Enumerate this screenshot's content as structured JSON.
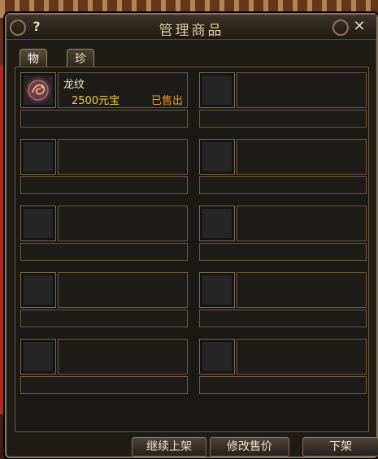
{
  "window": {
    "title": "管理商品",
    "help": "?",
    "close": "✕"
  },
  "tabs": [
    {
      "label": "物品",
      "active": true
    },
    {
      "label": "珍兽",
      "active": false
    }
  ],
  "items": [
    {
      "name": "龙纹",
      "price": "2500元宝",
      "status": "已售出",
      "icon": "dragon-emblem-icon"
    },
    {
      "name": "",
      "price": "",
      "status": ""
    },
    {
      "name": "",
      "price": "",
      "status": ""
    },
    {
      "name": "",
      "price": "",
      "status": ""
    },
    {
      "name": "",
      "price": "",
      "status": ""
    },
    {
      "name": "",
      "price": "",
      "status": ""
    },
    {
      "name": "",
      "price": "",
      "status": ""
    },
    {
      "name": "",
      "price": "",
      "status": ""
    },
    {
      "name": "",
      "price": "",
      "status": ""
    },
    {
      "name": "",
      "price": "",
      "status": ""
    }
  ],
  "buttons": {
    "relist": "继续上架",
    "edit_price": "修改售价",
    "remove": "下架"
  },
  "colors": {
    "price": "#f2cf3a",
    "status_sold": "#f29b1e",
    "frame": "#8a7656"
  }
}
